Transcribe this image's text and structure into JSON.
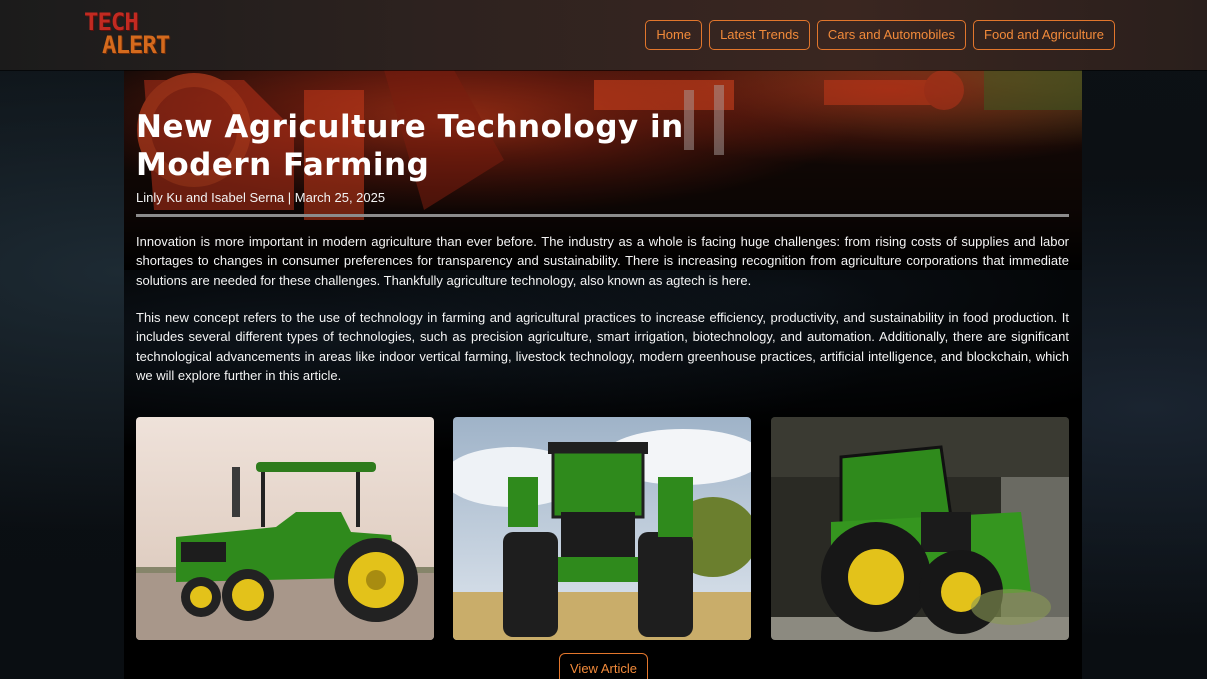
{
  "header": {
    "logo_line1": "TECH",
    "logo_line2": "ALERT",
    "nav": [
      "Home",
      "Latest Trends",
      "Cars and Automobiles",
      "Food and Agriculture"
    ]
  },
  "article": {
    "title": "New Agriculture Technology in Modern Farming",
    "byline": "Linly Ku and Isabel Serna | March 25, 2025",
    "paragraphs": [
      "Innovation is more important in modern agriculture than ever before. The industry as a whole is facing huge challenges: from rising costs of supplies and labor shortages to changes in consumer preferences for transparency and sustainability. There is increasing recognition from agriculture corporations that immediate solutions are needed for these challenges. Thankfully agriculture technology, also known as agtech is here.",
      "This new concept refers to the use of technology in farming and agricultural practices to increase efficiency, productivity, and sustainability in food production. It includes several different types of technologies, such as precision agriculture, smart irrigation, biotechnology, and automation. Additionally, there are significant technological advancements in areas like indoor vertical farming, livestock technology, modern greenhouse practices, artificial intelligence, and blockchain, which we will explore further in this article."
    ],
    "view_button": "View Article"
  },
  "colors": {
    "accent": "#e2762c",
    "tractor_green": "#2f8a1c",
    "tractor_yellow": "#e3c21a"
  }
}
